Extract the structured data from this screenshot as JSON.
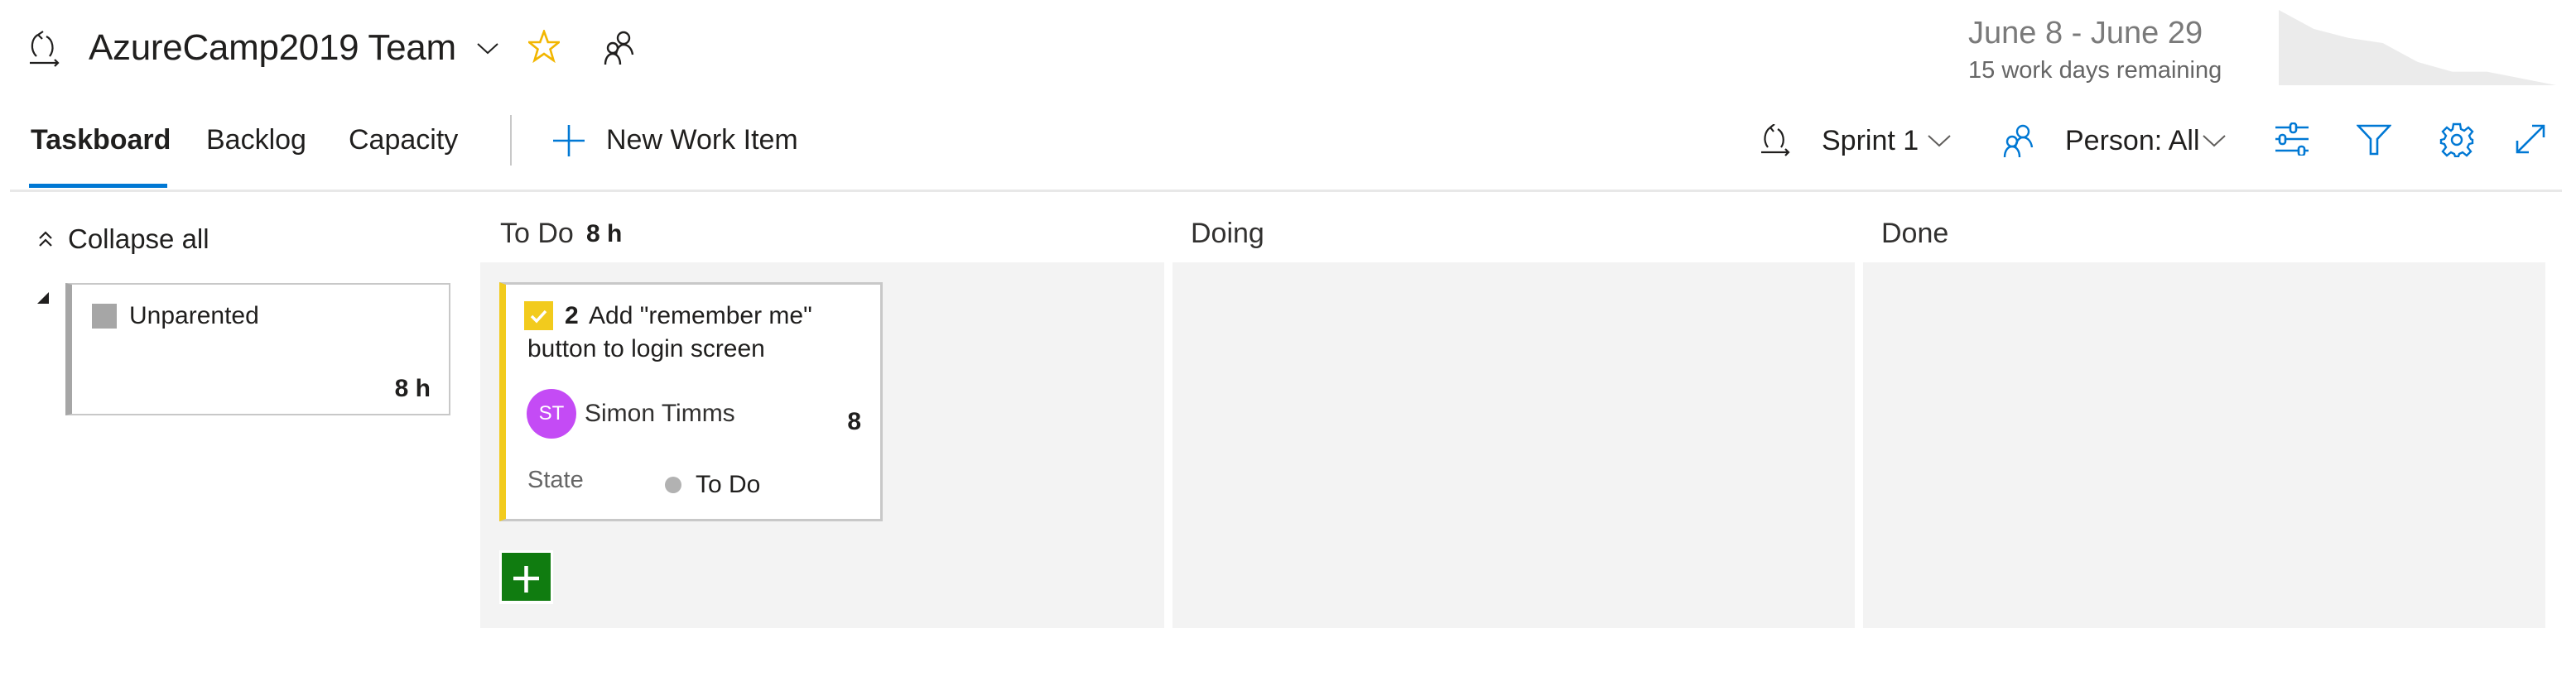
{
  "header": {
    "team_name": "AzureCamp2019 Team",
    "sprint_dates": "June 8 - June 29",
    "sprint_remaining": "15 work days remaining",
    "icons": {
      "team": "sprint-cycle-icon",
      "team_dropdown": "chevron-down-icon",
      "favorite": "star-icon",
      "members": "people-icon"
    },
    "burndown_trend": [
      1.0,
      0.75,
      0.63,
      0.56,
      0.31,
      0.18,
      0.18,
      0.09,
      0.0
    ],
    "colors": {
      "favorite": "#f2b600",
      "accent": "#0078d4",
      "burndown": "#ebebeb"
    }
  },
  "toolbar": {
    "tabs": [
      {
        "label": "Taskboard",
        "selected": true
      },
      {
        "label": "Backlog",
        "selected": false
      },
      {
        "label": "Capacity",
        "selected": false
      }
    ],
    "new_work_item": "New Work Item",
    "sprint_picker": {
      "label": "Sprint 1",
      "icon": "sprint-cycle-icon"
    },
    "person_filter": {
      "label": "Person: All",
      "icon": "people-icon"
    },
    "actions": [
      {
        "name": "view-options",
        "icon": "sliders-icon"
      },
      {
        "name": "filter",
        "icon": "filter-icon"
      },
      {
        "name": "settings",
        "icon": "gear-icon"
      },
      {
        "name": "full-screen",
        "icon": "expand-icon"
      }
    ]
  },
  "board": {
    "collapse_all": "Collapse all",
    "parent_row": {
      "title": "Unparented",
      "remaining": "8 h",
      "color": "#a6a6a6"
    },
    "columns": [
      {
        "title": "To Do",
        "remaining": "8 h"
      },
      {
        "title": "Doing",
        "remaining": ""
      },
      {
        "title": "Done",
        "remaining": ""
      }
    ],
    "cards": [
      {
        "id": "2",
        "title": "Add \"remember me\" button to login screen",
        "type_icon": "task-check-icon",
        "type_color": "#f2cb1d",
        "assignee": "Simon Timms",
        "avatar_initials": "ST",
        "avatar_color": "#c44bf5",
        "remaining": "8",
        "state_label": "State",
        "state": "To Do",
        "state_color": "#b2b2b2",
        "column": "To Do"
      }
    ],
    "add_button_color": "#107c10"
  }
}
